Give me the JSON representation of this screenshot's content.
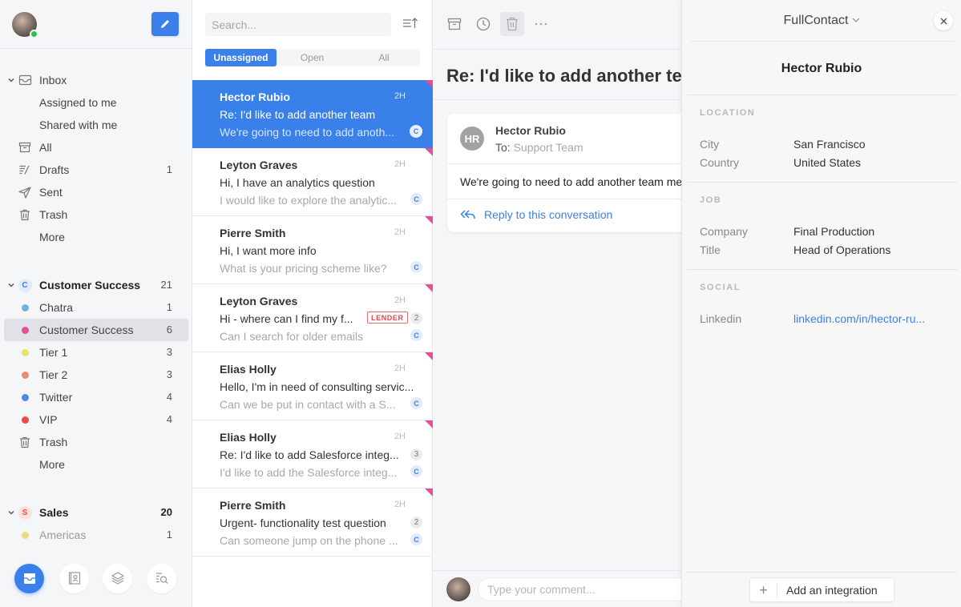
{
  "sidebar": {
    "compose_label": "Compose",
    "inbox": {
      "label": "Inbox",
      "items": [
        {
          "label": "Assigned to me",
          "count": ""
        },
        {
          "label": "Shared with me",
          "count": ""
        },
        {
          "label": "All",
          "icon": "archive-icon",
          "count": ""
        },
        {
          "label": "Drafts",
          "icon": "drafts-icon",
          "count": "1"
        },
        {
          "label": "Sent",
          "icon": "send-icon",
          "count": ""
        },
        {
          "label": "Trash",
          "icon": "trash-icon",
          "count": ""
        },
        {
          "label": "More",
          "count": ""
        }
      ]
    },
    "team_cs": {
      "letter": "C",
      "label": "Customer Success",
      "count": "21",
      "color": "#3a80ea",
      "items": [
        {
          "label": "Chatra",
          "count": "1",
          "color": "#6cb4d9"
        },
        {
          "label": "Customer Success",
          "count": "6",
          "color": "#e0519a",
          "active": true
        },
        {
          "label": "Tier 1",
          "count": "3",
          "color": "#e5e26e"
        },
        {
          "label": "Tier 2",
          "count": "3",
          "color": "#f0896a"
        },
        {
          "label": "Twitter",
          "count": "4",
          "color": "#4a8bea"
        },
        {
          "label": "VIP",
          "count": "4",
          "color": "#ee4a43"
        },
        {
          "label": "Trash",
          "count": ""
        },
        {
          "label": "More",
          "count": ""
        }
      ]
    },
    "team_sales": {
      "letter": "S",
      "label": "Sales",
      "count": "20",
      "color": "#ee4a43",
      "items": [
        {
          "label": "Americas",
          "count": "1",
          "color": "#e8de7a"
        }
      ]
    },
    "bottom_nav": [
      "inbox",
      "contacts",
      "layers",
      "search-list"
    ]
  },
  "list": {
    "search_placeholder": "Search...",
    "tabs": [
      "Unassigned",
      "Open",
      "All"
    ],
    "active_tab": "Unassigned",
    "conversations": [
      {
        "name": "Hector Rubio",
        "time": "2H",
        "subject": "Re: I'd like to add another team",
        "preview": "We're going to need to add anoth...",
        "badge": "C",
        "selected": true
      },
      {
        "name": "Leyton Graves",
        "time": "2H",
        "subject": "Hi, I have an analytics question",
        "preview": "I would like to explore the analytic...",
        "badge": "C"
      },
      {
        "name": "Pierre Smith",
        "time": "2H",
        "subject": "Hi, I want more info",
        "preview": "What is your pricing scheme like?",
        "badge": "C"
      },
      {
        "name": "Leyton Graves",
        "time": "2H",
        "subject": "Hi - where can I find my f...",
        "preview": "Can I search for older emails",
        "badge": "C",
        "tag": "LENDER",
        "count": "2"
      },
      {
        "name": "Elias Holly",
        "time": "2H",
        "subject": "Hello, I'm in need of consulting servic...",
        "preview": "Can we be put in contact with a S...",
        "badge": "C"
      },
      {
        "name": "Elias Holly",
        "time": "2H",
        "subject": "Re: I'd like to add Salesforce integ...",
        "preview": "I'd like to add the Salesforce integ...",
        "badge": "C",
        "count": "3"
      },
      {
        "name": "Pierre Smith",
        "time": "2H",
        "subject": "Urgent- functionality test question",
        "preview": "Can someone jump on the phone ...",
        "badge": "C",
        "count": "2"
      }
    ]
  },
  "conversation": {
    "title": "Re: I'd like to add another team",
    "message": {
      "initials": "HR",
      "from": "Hector Rubio",
      "to_label": "To:",
      "to_value": "Support Team",
      "body": "We're going to need to add another team member"
    },
    "reply_label": "Reply to this conversation",
    "comment_placeholder": "Type your comment..."
  },
  "contact_panel": {
    "integration": "FullContact",
    "name": "Hector Rubio",
    "sections": {
      "location": {
        "title": "LOCATION",
        "rows": [
          {
            "key": "City",
            "value": "San Francisco"
          },
          {
            "key": "Country",
            "value": "United States"
          }
        ]
      },
      "job": {
        "title": "JOB",
        "rows": [
          {
            "key": "Company",
            "value": "Final Production"
          },
          {
            "key": "Title",
            "value": "Head of Operations"
          }
        ]
      },
      "social": {
        "title": "SOCIAL",
        "rows": [
          {
            "key": "Linkedin",
            "value": "linkedin.com/in/hector-ru..."
          }
        ]
      }
    },
    "add_integration_label": "Add an integration"
  },
  "colors": {
    "accent": "#3a80ea",
    "tag_corner": "#e0519a",
    "online": "#2ac34f",
    "lender_tag": "#e64545"
  }
}
